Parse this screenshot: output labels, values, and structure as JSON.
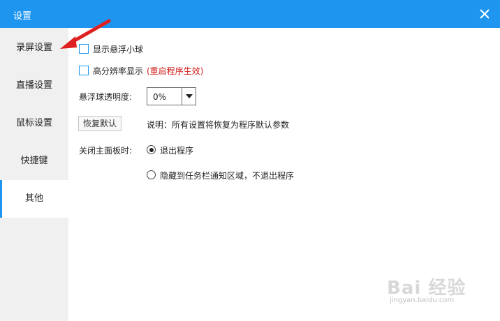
{
  "window": {
    "title": "设置",
    "close_icon": "close-icon"
  },
  "sidebar": {
    "items": [
      {
        "label": "录屏设置",
        "active": false
      },
      {
        "label": "直播设置",
        "active": false
      },
      {
        "label": "鼠标设置",
        "active": false
      },
      {
        "label": "快捷键",
        "active": false
      },
      {
        "label": "其他",
        "active": true
      }
    ]
  },
  "settings": {
    "floating_ball_label": "显示悬浮小球",
    "floating_ball_checked": false,
    "hidpi_label": "高分辨率显示",
    "hidpi_note": "(重启程序生效)",
    "hidpi_checked": false,
    "opacity_label": "悬浮球透明度:",
    "opacity_value": "0%",
    "reset_button": "恢复默认",
    "reset_description": "说明：所有设置将恢复为程序默认参数",
    "close_panel_label": "关闭主面板时:",
    "close_options": [
      {
        "label": "退出程序",
        "selected": true
      },
      {
        "label": "隐藏到任务栏通知区域，不退出程序",
        "selected": false
      }
    ]
  },
  "watermark": {
    "logo": "Bai 经验",
    "url": "jingyan.baidu.com"
  },
  "colors": {
    "accent": "#1e96f0",
    "sidebar_bg": "#f0f0f0",
    "note_red": "#d0201c",
    "annotation_arrow": "#e02020"
  }
}
